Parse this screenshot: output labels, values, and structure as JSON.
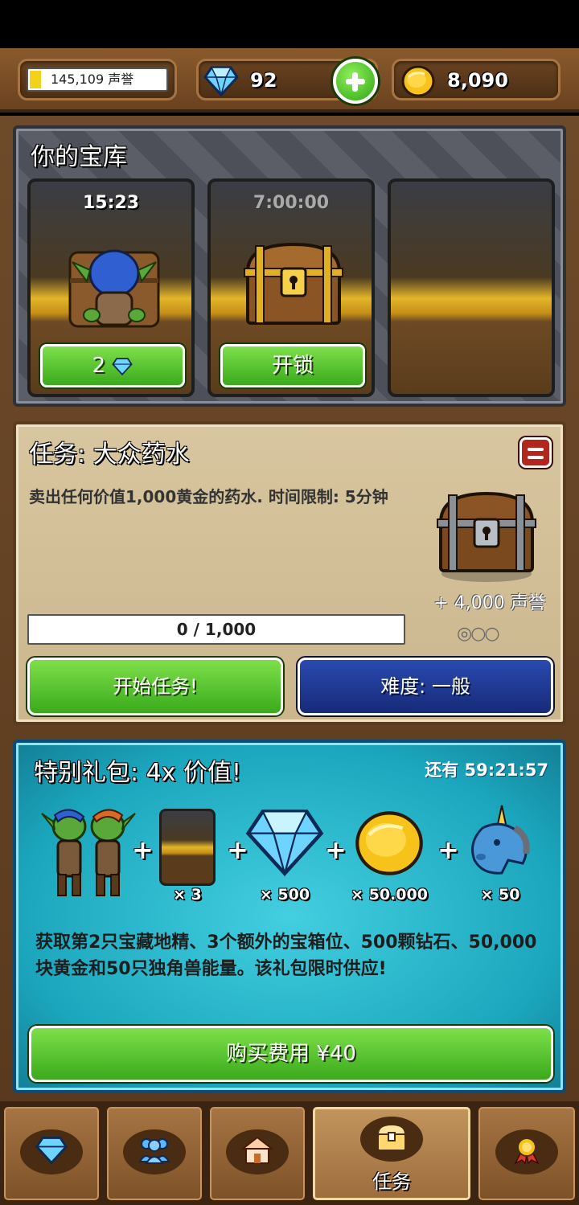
{
  "header": {
    "reputation": "145,109 声誉",
    "reputation_fill_fraction": 0.08,
    "gems": "92",
    "gold": "8,090",
    "add_icon": "plus-icon",
    "gem_icon": "diamond-icon",
    "gold_icon": "coin-icon"
  },
  "vault": {
    "title": "你的宝库",
    "slots": [
      {
        "timer": "15:23",
        "button_label": "2",
        "content": "goblin-icon"
      },
      {
        "timer": "7:00:00",
        "button_label": "开锁",
        "content": "treasure-chest-icon"
      },
      {
        "timer": "",
        "button_label": "",
        "content": "empty"
      }
    ]
  },
  "quest": {
    "title": "任务: 大众药水",
    "description": "卖出任何价值1,000黄金的药水. 时间限制: 5分钟",
    "progress": "0 / 1,000",
    "reward": "+ 4,000 声誉",
    "difficulty_dots": "◎○○",
    "start_label": "开始任务!",
    "difficulty_label": "难度: 一般"
  },
  "offer": {
    "title": "特别礼包: 4x 价值!",
    "timer": "还有 59:21:57",
    "items": [
      {
        "icon": "goblins-icon",
        "qty": ""
      },
      {
        "icon": "vault-slot-icon",
        "qty": "× 3"
      },
      {
        "icon": "diamond-icon",
        "qty": "× 500"
      },
      {
        "icon": "coin-icon",
        "qty": "× 50.000"
      },
      {
        "icon": "unicorn-icon",
        "qty": "× 50"
      }
    ],
    "description": "获取第2只宝藏地精、3个额外的宝箱位、500颗钻石、50,000块黄金和50只独角兽能量。该礼包限时供应!",
    "buy_label": "购买费用 ¥40"
  },
  "nav": {
    "tabs": [
      {
        "icon": "diamond-icon",
        "label": ""
      },
      {
        "icon": "people-icon",
        "label": ""
      },
      {
        "icon": "buildings-icon",
        "label": ""
      },
      {
        "icon": "treasure-chest-icon",
        "label": "任务",
        "active": true
      },
      {
        "icon": "medal-icon",
        "label": ""
      }
    ]
  },
  "colors": {
    "wood": "#8a5a2c",
    "green_button": "#3aaa1c",
    "blue_button": "#162a78",
    "offer_panel": "#1ba6bd"
  }
}
